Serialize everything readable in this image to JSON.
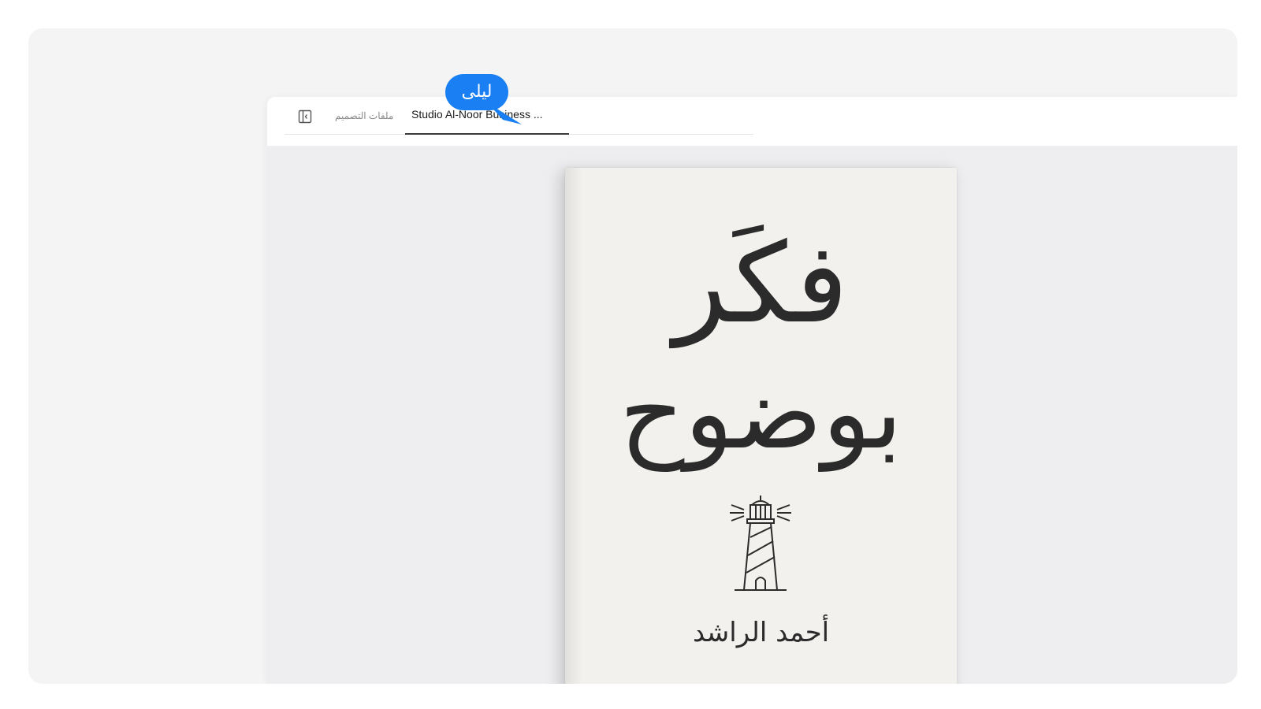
{
  "tabs": {
    "files_label": "ملفات التصميم",
    "active_label": "Studio Al-Noor Business ..."
  },
  "book": {
    "title_line1": "فكَر",
    "title_line2": "بوضوح",
    "author": "أحمد الراشد",
    "illustration": "lighthouse-icon"
  },
  "collaborator": {
    "name": "ليلى",
    "color": "#1a7ff2"
  },
  "icons": {
    "sidebar_toggle": "sidebar-toggle-icon"
  }
}
